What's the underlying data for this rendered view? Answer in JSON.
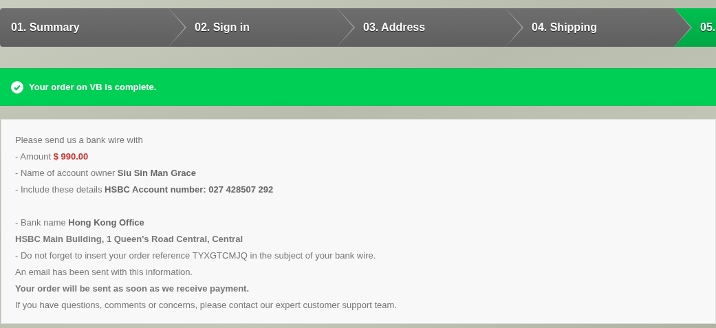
{
  "steps": [
    {
      "label": "01. Summary",
      "selected": false
    },
    {
      "label": "02. Sign in",
      "selected": false
    },
    {
      "label": "03. Address",
      "selected": false
    },
    {
      "label": "04. Shipping",
      "selected": false
    },
    {
      "label": "05.",
      "selected": true
    }
  ],
  "alert": {
    "text": "Your order on VB is complete."
  },
  "message": {
    "groups": [
      {
        "lines": [
          {
            "text": "Please send us a bank wire with"
          },
          {
            "text": "- Amount",
            "price": "$ 990.00"
          },
          {
            "text": "- Name of account owner",
            "strong": "Siu Sin Man Grace"
          },
          {
            "text": "- Include these details",
            "strong": "HSBC Account number: 027 428507 292"
          }
        ]
      },
      {
        "lines": [
          {
            "text": "- Bank name",
            "strong": "Hong Kong Office"
          },
          {
            "text": "HSBC Main Building, 1 Queen's Road Central, Central",
            "bold": true
          },
          {
            "text": "- Do not forget to insert your order reference TYXGTCMJQ in the subject of your bank wire."
          },
          {
            "text": "An email has been sent with this information."
          },
          {
            "text": "Your order will be sent as soon as we receive payment.",
            "bold": true
          },
          {
            "text": "If you have questions, comments or concerns, please contact our expert customer support team."
          }
        ]
      }
    ]
  }
}
